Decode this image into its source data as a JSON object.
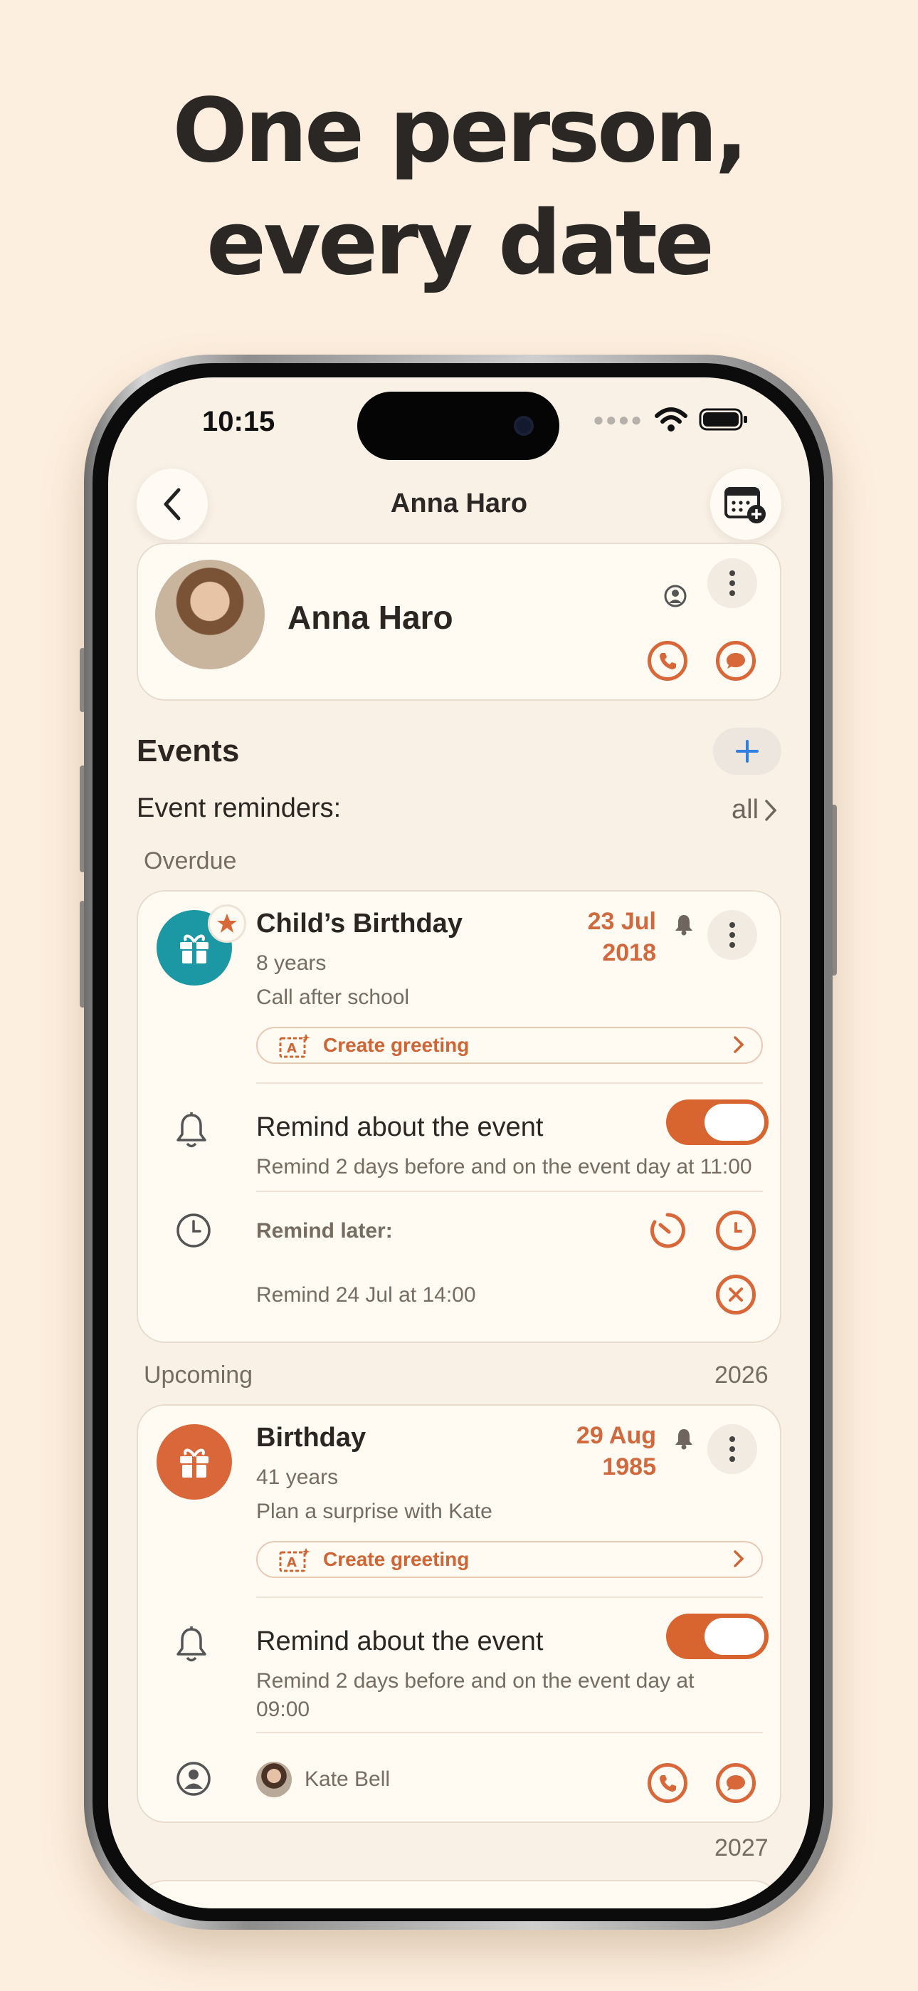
{
  "headline": {
    "line1": "One person,",
    "line2": "every date"
  },
  "status_bar": {
    "time": "10:15"
  },
  "nav": {
    "title": "Anna Haro"
  },
  "contact": {
    "name": "Anna Haro"
  },
  "events": {
    "title": "Events",
    "reminders_label": "Event reminders:",
    "reminders_value": "all",
    "overdue_label": "Overdue",
    "upcoming_label": "Upcoming",
    "upcoming_year": "2026",
    "next_year": "2027"
  },
  "event1": {
    "title": "Child’s Birthday",
    "subtitle": "8 years",
    "note": "Call after school",
    "date_day": "23 Jul",
    "date_year": "2018",
    "greeting_label": "Create greeting",
    "remind_title": "Remind about the event",
    "remind_detail": "Remind 2 days before and on the event day at 11:00",
    "remind_later_label": "Remind later:",
    "remind_later_detail": "Remind 24 Jul at 14:00",
    "icon_color": "#1b98a4"
  },
  "event2": {
    "title": "Birthday",
    "subtitle": "41 years",
    "note": "Plan a surprise with Kate",
    "date_day": "29 Aug",
    "date_year": "1985",
    "greeting_label": "Create greeting",
    "remind_title": "Remind about the event",
    "remind_detail_1": "Remind 2 days before and on the event day at",
    "remind_detail_2": "09:00",
    "linked_contact": "Kate Bell",
    "icon_color": "#d9673a"
  },
  "colors": {
    "accent": "#d8683a",
    "background": "#fdefdf",
    "blue_plus": "#2f7fe0"
  }
}
